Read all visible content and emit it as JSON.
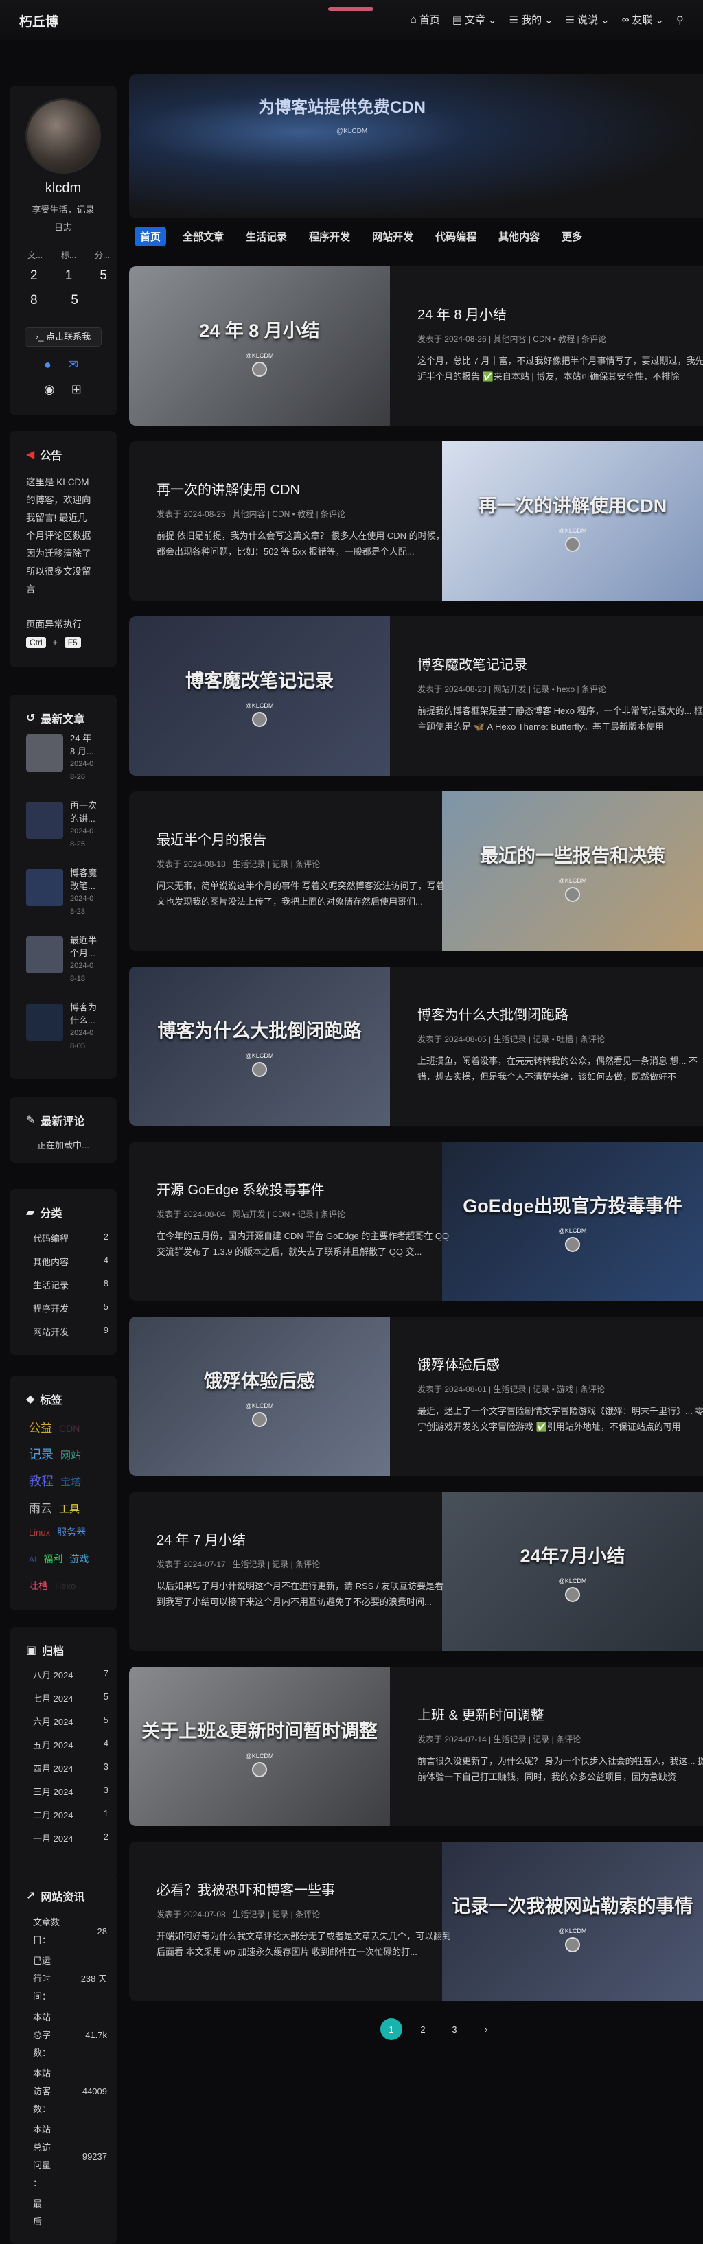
{
  "nav": {
    "brand": "朽丘博",
    "items": [
      "首页",
      "文章",
      "我的",
      "说说",
      "友联"
    ]
  },
  "profile": {
    "name": "klcdm",
    "desc_1": "享受生活，记录",
    "desc_2": "日志",
    "stat_labels": [
      "文...",
      "标...",
      "分..."
    ],
    "stat_values_1": [
      "2",
      "1",
      "5"
    ],
    "stat_values_2": [
      "8",
      "5"
    ],
    "contact": "点击联系我"
  },
  "notice": {
    "title": "公告",
    "lines": [
      "这里是 KLCDM",
      "的博客，欢迎向",
      "我留言! 最近几",
      "个月评论区数据",
      "因为迁移清除了",
      "所以很多文没留",
      "言"
    ],
    "anomaly": "页面异常执行",
    "key1": "Ctrl",
    "plus": "+",
    "key2": "F5"
  },
  "recent": {
    "title": "最新文章",
    "items": [
      {
        "t1": "24 年",
        "t2": "8 月...",
        "date": "2024-0",
        "date2": "8-26"
      },
      {
        "t1": "再一次",
        "t2": "的讲...",
        "date": "2024-0",
        "date2": "8-25"
      },
      {
        "t1": "博客魔",
        "t2": "改笔...",
        "date": "2024-0",
        "date2": "8-23"
      },
      {
        "t1": "最近半",
        "t2": "个月...",
        "date": "2024-0",
        "date2": "8-18"
      },
      {
        "t1": "博客为",
        "t2": "什么...",
        "date": "2024-0",
        "date2": "8-05"
      }
    ]
  },
  "comments": {
    "title": "最新评论",
    "loading": "正在加载中..."
  },
  "categories": {
    "title": "分类",
    "items": [
      {
        "n": "代码编程",
        "c": "2"
      },
      {
        "n": "其他内容",
        "c": "4"
      },
      {
        "n": "生活记录",
        "c": "8"
      },
      {
        "n": "程序开发",
        "c": "5"
      },
      {
        "n": "网站开发",
        "c": "9"
      }
    ]
  },
  "tags": {
    "title": "标签",
    "rows": [
      [
        "公益",
        "CDN"
      ],
      [
        "记录",
        "网站"
      ],
      [
        "教程",
        "宝塔"
      ],
      [
        "雨云",
        "工具"
      ],
      [
        "Linux",
        "服务器"
      ],
      [
        "AI",
        "福利",
        "游戏"
      ],
      [
        "吐槽",
        "Hexo"
      ]
    ]
  },
  "archives": {
    "title": "归档",
    "items": [
      {
        "m": "八月 2024",
        "c": "7"
      },
      {
        "m": "七月 2024",
        "c": "5"
      },
      {
        "m": "六月 2024",
        "c": "5"
      },
      {
        "m": "五月 2024",
        "c": "4"
      },
      {
        "m": "四月 2024",
        "c": "3"
      },
      {
        "m": "三月 2024",
        "c": "3"
      },
      {
        "m": "二月 2024",
        "c": "1"
      },
      {
        "m": "一月 2024",
        "c": "2"
      }
    ]
  },
  "siteinfo": {
    "title": "网站资讯",
    "items": [
      {
        "k": [
          "文章数",
          "目："
        ],
        "v": "28"
      },
      {
        "k": [
          "已运",
          "行时",
          "间："
        ],
        "v": "238 天"
      },
      {
        "k": [
          "本站",
          "总字",
          "数："
        ],
        "v": "41.7k"
      },
      {
        "k": [
          "本站",
          "访客",
          "数："
        ],
        "v": "44009"
      },
      {
        "k": [
          "本站",
          "总访",
          "问量",
          "："
        ],
        "v": "99237"
      },
      {
        "k": [
          "最",
          "后"
        ],
        "v": ""
      }
    ]
  },
  "banner": {
    "title": "为博客站提供免费CDN",
    "sub": "@KLCDM"
  },
  "tabs": [
    "首页",
    "全部文章",
    "生活记录",
    "程序开发",
    "网站开发",
    "代码编程",
    "其他内容",
    "更多"
  ],
  "posts": [
    {
      "img": "24 年 8 月小结",
      "title": "24 年 8 月小结",
      "meta": "发表于 2024-08-26 | 其他内容 | CDN • 教程 | 条评论",
      "desc": "这个月，总比 7 月丰富，不过我好像把半个月事情写了，要过期过，我先... 近半个月的报告 ✅来自本站 | 博友，本站可确保其安全性，不排除"
    },
    {
      "img": "再一次的讲解使用CDN",
      "title": "再一次的讲解使用 CDN",
      "meta": "发表于 2024-08-25 | 其他内容 | CDN • 教程 | 条评论",
      "desc": "前提 依旧是前提，我为什么会写这篇文章？ 很多人在使用 CDN 的时候，都会出现各种问题，比如：502 等 5xx 报错等，一般都是个人配..."
    },
    {
      "img": "博客魔改笔记记录",
      "title": "博客魔改笔记记录",
      "meta": "发表于 2024-08-23 | 网站开发 | 记录 • hexo | 条评论",
      "desc": "前提我的博客框架是基于静态博客 Hexo 程序，一个非常简洁强大的... 框架 主题使用的是 🦋 A Hexo Theme: Butterfly。基于最新版本使用"
    },
    {
      "img": "最近的一些报告和决策",
      "title": "最近半个月的报告",
      "meta": "发表于 2024-08-18 | 生活记录 | 记录 | 条评论",
      "desc": "闲来无事，简单说说这半个月的事件 写着文呢突然博客没法访问了，写着文也发现我的图片没法上传了，我把上面的对象储存然后使用哥们..."
    },
    {
      "img": "博客为什么大批倒闭跑路",
      "title": "博客为什么大批倒闭跑路",
      "meta": "发表于 2024-08-05 | 生活记录 | 记录 • 吐槽 | 条评论",
      "desc": "上班摸鱼，闲着没事，在壳壳转转我的公众，偶然看见一条消息 想... 不错，想去实操，但是我个人不清楚头绪，该如何去做，既然做好不"
    },
    {
      "img": "GoEdge出现官方投毒事件",
      "title": "开源 GoEdge 系统投毒事件",
      "meta": "发表于 2024-08-04 | 网站开发 | CDN • 记录 | 条评论",
      "desc": "在今年的五月份，国内开源自建 CDN 平台 GoEdge 的主要作者超哥在 QQ 交流群发布了 1.3.9 的版本之后，就失去了联系并且解散了 QQ 交..."
    },
    {
      "img": "饿殍体验后感",
      "title": "饿殍体验后感",
      "meta": "发表于 2024-08-01 | 生活记录 | 记录 • 游戏 | 条评论",
      "desc": "最近，迷上了一个文字冒险剧情文字冒险游戏《饿殍：明末千里行》... 零宁创游戏开发的文字冒险游戏 ✅引用站外地址，不保证站点的可用"
    },
    {
      "img": "24年7月小结",
      "title": "24 年 7 月小结",
      "meta": "发表于 2024-07-17 | 生活记录 | 记录 | 条评论",
      "desc": "以后如果写了月小计说明这个月不在进行更新，请 RSS / 友联互访要是看到我写了小结可以接下来这个月内不用互访避免了不必要的浪费时间..."
    },
    {
      "img": "关于上班&更新时间暂时调整",
      "title": "上班 & 更新时间调整",
      "meta": "发表于 2024-07-14 | 生活记录 | 记录 | 条评论",
      "desc": "前言很久没更新了，为什么呢？ 身为一个快步入社会的牲畜人，我这... 提前体验一下自己打工赚钱，同时，我的众多公益项目，因为急缺资"
    },
    {
      "img": "记录一次我被网站勒索的事情",
      "title": "必看？我被恐吓和博客一些事",
      "meta": "发表于 2024-07-08 | 生活记录 | 记录 | 条评论",
      "desc": "开端如何好奇为什么我文章评论大部分无了或者是文章丢失几个，可以翻到后面看 本文采用 wp 加速永久缓存图片 收到邮件在一次忙碌的打..."
    }
  ],
  "pagination": [
    "1",
    "2",
    "3",
    "›"
  ],
  "colors": {
    "accent": "#1b66d6",
    "page_active": "#19b3ad"
  }
}
